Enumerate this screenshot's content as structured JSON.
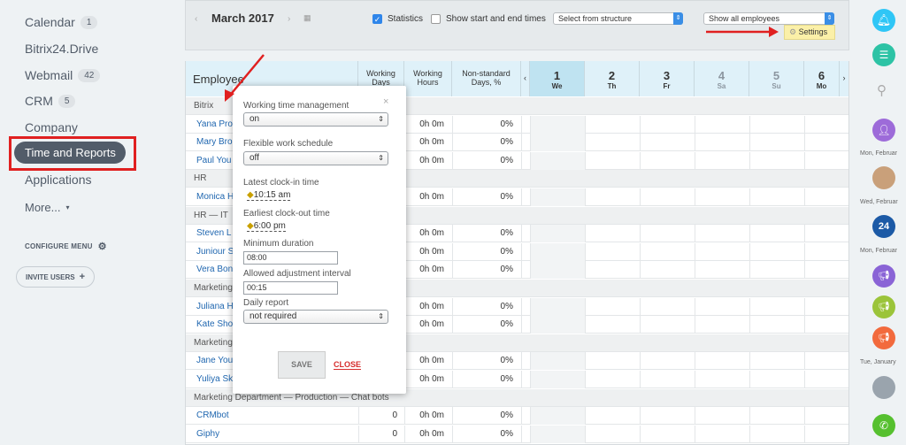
{
  "nav": {
    "calendar": "Calendar",
    "calendar_badge": "1",
    "drive": "Bitrix24.Drive",
    "webmail": "Webmail",
    "webmail_badge": "42",
    "crm": "CRM",
    "crm_badge": "5",
    "company": "Company",
    "time": "Time and Reports",
    "apps": "Applications",
    "more": "More...",
    "configure": "CONFIGURE MENU",
    "invite": "INVITE USERS"
  },
  "toolbar": {
    "month": "March 2017",
    "statistics": "Statistics",
    "start_end": "Show start and end times",
    "structure": "Select from structure",
    "employees": "Show all employees",
    "settings": "Settings"
  },
  "grid": {
    "headers": {
      "employee": "Employee",
      "working_days": "Working Days",
      "working_hours": "Working Hours",
      "nonstd": "Non-standard Days, %"
    },
    "days": [
      {
        "num": "1",
        "wd": "We"
      },
      {
        "num": "2",
        "wd": "Th"
      },
      {
        "num": "3",
        "wd": "Fr"
      },
      {
        "num": "4",
        "wd": "Sa"
      },
      {
        "num": "5",
        "wd": "Su"
      },
      {
        "num": "6",
        "wd": "Mo"
      }
    ],
    "rows": [
      {
        "type": "group",
        "text": "Bitrix"
      },
      {
        "type": "emp",
        "name": "Yana Pro",
        "hours": "0h 0m",
        "pct": "0%"
      },
      {
        "type": "emp",
        "name": "Mary Bro",
        "hours": "0h 0m",
        "pct": "0%"
      },
      {
        "type": "emp",
        "name": "Paul You",
        "hours": "0h 0m",
        "pct": "0%"
      },
      {
        "type": "group",
        "text": "HR"
      },
      {
        "type": "emp",
        "name": "Monica H",
        "hours": "0h 0m",
        "pct": "0%"
      },
      {
        "type": "group",
        "text": "HR — IT"
      },
      {
        "type": "emp",
        "name": "Steven L",
        "hours": "0h 0m",
        "pct": "0%"
      },
      {
        "type": "emp",
        "name": "Juniour S",
        "hours": "0h 0m",
        "pct": "0%"
      },
      {
        "type": "emp",
        "name": "Vera Bon",
        "hours": "0h 0m",
        "pct": "0%"
      },
      {
        "type": "group",
        "text": "Marketing"
      },
      {
        "type": "emp",
        "name": "Juliana H",
        "hours": "0h 0m",
        "pct": "0%"
      },
      {
        "type": "emp",
        "name": "Kate Sho",
        "hours": "0h 0m",
        "pct": "0%"
      },
      {
        "type": "group",
        "text": "Marketing"
      },
      {
        "type": "emp",
        "name": "Jane You",
        "hours": "0h 0m",
        "pct": "0%"
      },
      {
        "type": "emp",
        "name": "Yuliya Sk",
        "hours": "0h 0m",
        "pct": "0%"
      },
      {
        "type": "group",
        "text": "Marketing Department — Production — Chat bots"
      },
      {
        "type": "emp",
        "name": "CRMbot",
        "days": "0",
        "hours": "0h 0m",
        "pct": "0%"
      },
      {
        "type": "emp",
        "name": "Giphy",
        "days": "0",
        "hours": "0h 0m",
        "pct": "0%"
      }
    ]
  },
  "popup": {
    "wtm_label": "Working time management",
    "wtm_value": "on",
    "flex_label": "Flexible work schedule",
    "flex_value": "off",
    "clockin_label": "Latest clock-in time",
    "clockin_value": "10:15 am",
    "clockout_label": "Earliest clock-out time",
    "clockout_value": "6:00 pm",
    "min_label": "Minimum duration",
    "min_value": "08:00",
    "adj_label": "Allowed adjustment interval",
    "adj_value": "00:15",
    "daily_label": "Daily report",
    "daily_value": "not required",
    "save": "SAVE",
    "close": "CLOSE"
  },
  "rightbar": {
    "d1": "Mon, Februar",
    "d2": "Wed, Februar",
    "d3": "Mon, Februar",
    "d4": "Tue, January",
    "b24": "24"
  },
  "colors": {
    "accent": "#2f86ea",
    "red": "#e02020",
    "header": "#dff1f9"
  }
}
